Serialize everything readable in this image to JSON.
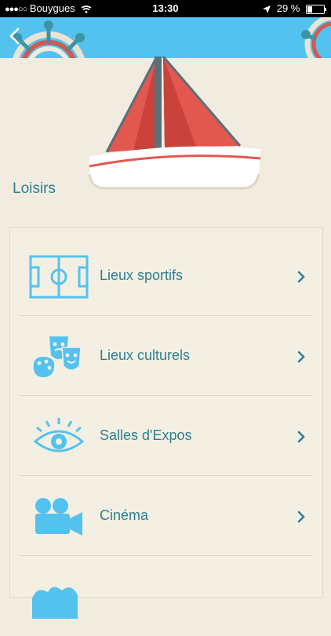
{
  "status_bar": {
    "carrier": "Bouygues",
    "time": "13:30",
    "battery": "29 %"
  },
  "nav": {
    "back_icon": "back-chevron-icon",
    "accent": "#54c2ef"
  },
  "section": {
    "title": "Loisirs"
  },
  "items": [
    {
      "label": "Lieux sportifs",
      "icon": "sports-field-icon"
    },
    {
      "label": "Lieux culturels",
      "icon": "theater-masks-palette-icon"
    },
    {
      "label": "Salles d'Expos",
      "icon": "eye-icon"
    },
    {
      "label": "Cinéma",
      "icon": "movie-camera-icon"
    },
    {
      "label": "",
      "icon": "partial-icon"
    }
  ],
  "colors": {
    "text": "#2f7f8f",
    "icon": "#54c2ef",
    "background": "#f1ecdf"
  }
}
